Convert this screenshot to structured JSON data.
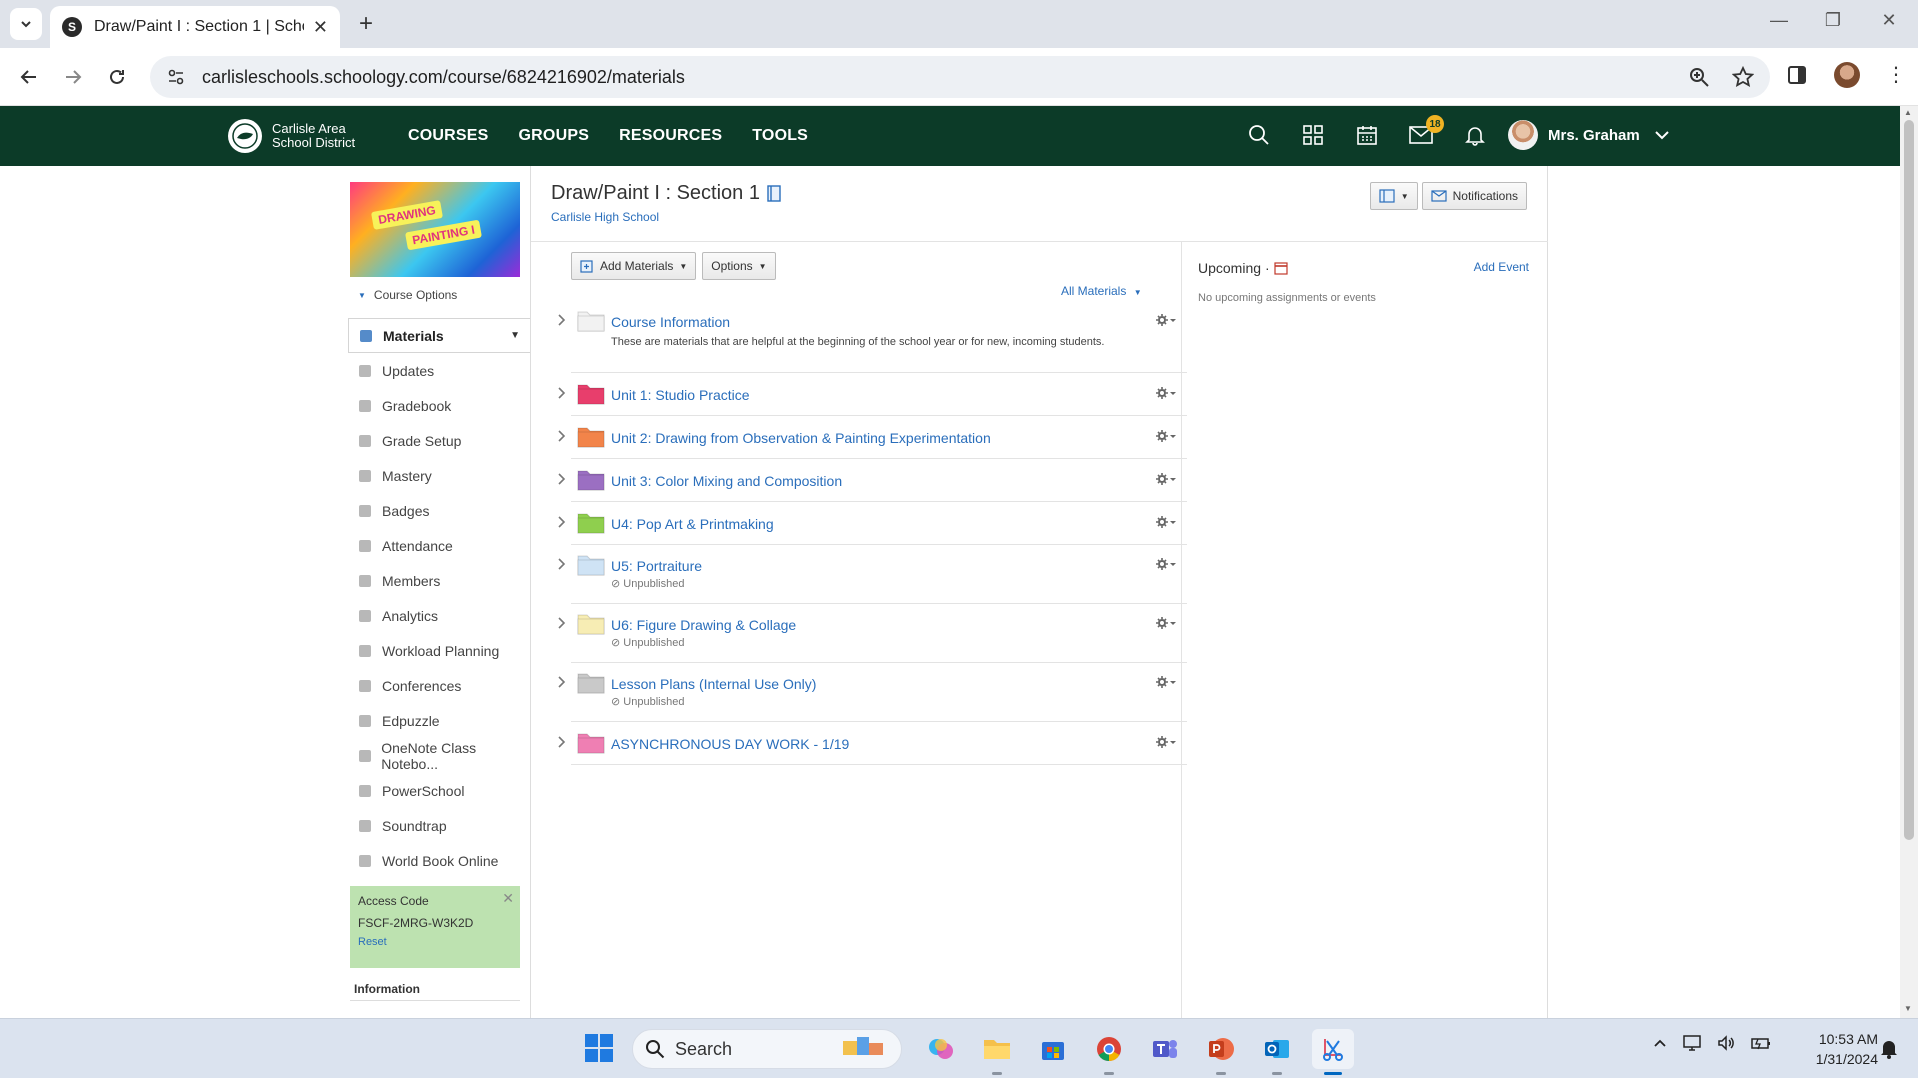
{
  "browser": {
    "tab_title": "Draw/Paint I : Section 1 | Schoology",
    "url": "carlisleschools.schoology.com/course/6824216902/materials"
  },
  "header": {
    "logo_line1": "Carlisle Area",
    "logo_line2": "School District",
    "nav": [
      "COURSES",
      "GROUPS",
      "RESOURCES",
      "TOOLS"
    ],
    "messages_badge": "18",
    "user_name": "Mrs. Graham"
  },
  "sidebar": {
    "course_image_text1": "DRAWING",
    "course_image_text2": "PAINTING I",
    "course_options": "Course Options",
    "items": [
      {
        "label": "Materials",
        "icon": "materials-icon"
      },
      {
        "label": "Updates",
        "icon": "updates-icon"
      },
      {
        "label": "Gradebook",
        "icon": "gradebook-icon"
      },
      {
        "label": "Grade Setup",
        "icon": "grade-setup-icon"
      },
      {
        "label": "Mastery",
        "icon": "mastery-icon"
      },
      {
        "label": "Badges",
        "icon": "badges-icon"
      },
      {
        "label": "Attendance",
        "icon": "attendance-icon"
      },
      {
        "label": "Members",
        "icon": "members-icon"
      },
      {
        "label": "Analytics",
        "icon": "analytics-icon"
      },
      {
        "label": "Workload Planning",
        "icon": "workload-icon"
      },
      {
        "label": "Conferences",
        "icon": "conferences-icon"
      },
      {
        "label": "Edpuzzle",
        "icon": "edpuzzle-icon"
      },
      {
        "label": "OneNote Class Notebo...",
        "icon": "onenote-icon"
      },
      {
        "label": "PowerSchool",
        "icon": "powerschool-icon"
      },
      {
        "label": "Soundtrap",
        "icon": "soundtrap-icon"
      },
      {
        "label": "World Book Online",
        "icon": "worldbook-icon"
      }
    ],
    "access_code_title": "Access Code",
    "access_code": "FSCF-2MRG-W3K2D",
    "access_reset": "Reset",
    "information": "Information"
  },
  "course": {
    "title": "Draw/Paint I : Section 1",
    "school": "Carlisle High School",
    "notifications_label": "Notifications"
  },
  "materials": {
    "add_materials": "Add Materials",
    "options": "Options",
    "filter": "All Materials",
    "folders": [
      {
        "title": "Course Information",
        "color": "#f2f2f2",
        "desc": "These are materials that are helpful at the beginning of the school year or for new, incoming students.",
        "status": ""
      },
      {
        "title": "Unit 1: Studio Practice",
        "color": "#e83e6c",
        "desc": "",
        "status": ""
      },
      {
        "title": "Unit 2: Drawing from Observation & Painting Experimentation",
        "color": "#f2844a",
        "desc": "",
        "status": ""
      },
      {
        "title": "Unit 3: Color Mixing and Composition",
        "color": "#9b6fc2",
        "desc": "",
        "status": ""
      },
      {
        "title": "U4: Pop Art & Printmaking",
        "color": "#8fcf4e",
        "desc": "",
        "status": ""
      },
      {
        "title": "U5: Portraiture",
        "color": "#cfe3f5",
        "desc": "",
        "status": "Unpublished"
      },
      {
        "title": "U6: Figure Drawing & Collage",
        "color": "#f7edb4",
        "desc": "",
        "status": "Unpublished"
      },
      {
        "title": "Lesson Plans (Internal Use Only)",
        "color": "#c9c9c9",
        "desc": "",
        "status": "Unpublished"
      },
      {
        "title": "ASYNCHRONOUS DAY WORK - 1/19",
        "color": "#ef7fb3",
        "desc": "",
        "status": ""
      }
    ]
  },
  "upcoming": {
    "title": "Upcoming",
    "separator": "·",
    "add_event": "Add Event",
    "empty": "No upcoming assignments or events"
  },
  "taskbar": {
    "search": "Search",
    "time": "10:53 AM",
    "date": "1/31/2024"
  }
}
